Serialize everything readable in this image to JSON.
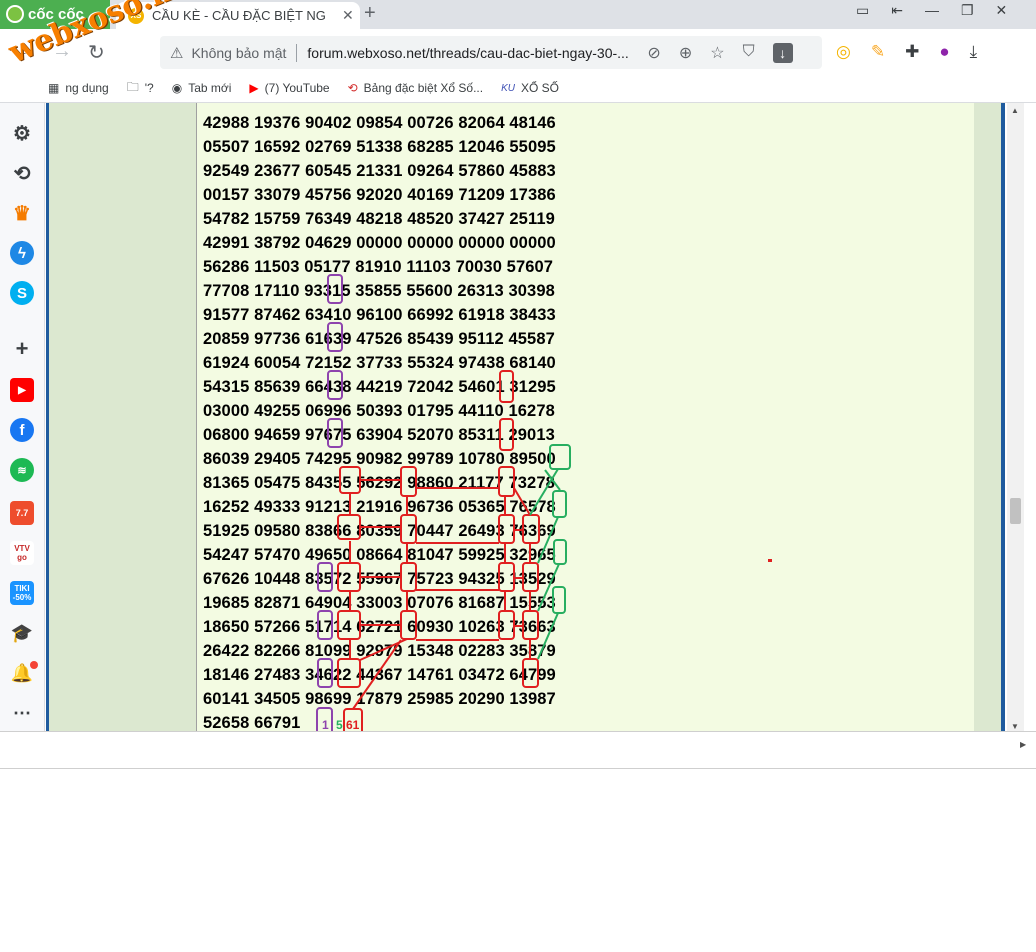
{
  "browser": {
    "brand": "cốc cốc",
    "tab_title": "CẦU KÈ - CẦU ĐẶC BIỆT NG",
    "tab_favicon": "XS",
    "tab_close": "✕",
    "new_tab": "+",
    "security_label": "Không bảo mật",
    "url": "forum.webxoso.net/threads/cau-dac-biet-ngay-30-..."
  },
  "bookmarks": [
    {
      "label": "ng dụng",
      "icon": "apps-icon"
    },
    {
      "label": "'?",
      "icon": "folder-icon"
    },
    {
      "label": "Tab mới",
      "icon": "globe-icon"
    },
    {
      "label": "(7) YouTube",
      "icon": "youtube-icon"
    },
    {
      "label": "Bảng đặc biệt Xổ Số...",
      "icon": "xs-icon"
    },
    {
      "label": "XỔ SỐ",
      "icon": "ku-icon"
    }
  ],
  "watermark": "webxoso.net",
  "sidebar": {
    "badges": {
      "shopee": "7.7",
      "vtv": "VTV go",
      "tiki": "TIKI -50%"
    }
  },
  "result_lines": [
    "42988 19376 90402 09854 00726 82064 48146",
    "05507 16592 02769 51338 68285 12046 55095",
    "92549 23677 60545 21331 09264 57860 45883",
    "00157 33079 45756 92020 40169 71209 17386",
    "54782 15759 76349 48218 48520 37427 25119",
    "42991 38792 04629 00000 00000 00000 00000",
    "56286 11503 05177 81910 11103 70030 57607",
    "77708 17110 93315 35855 55600 26313 30398",
    "91577 87462 63410 96100 66992 61918 38433",
    "20859 97736 61639 47526 85439 95112 45587",
    "61924 60054 72152 37733 55324 97438 68140",
    "54315 85639 66438 44219 72042 54601 31295",
    "03000 49255 06996 50393 01795 44110 16278",
    "06800 94659 97675 63904 52070 85311 29013",
    "86039 29405 74295 90982 99789 10780 89500",
    "81365 05475 84355 56292 98860 21177 73278",
    "16252 49333 91213 21916 96736 05365 76578",
    "51925 09580 83866 80359 70447 26493 76369",
    "54247 57470 49650 08664 81047 59925 32965",
    "67626 10448 83572 55967 75723 94325 13529",
    "19685 82871 64904 33003 07076 81687 15553",
    "18650 57266 51714 62721 60930 10263 73663",
    "26422 82266 81099 92979 15348 02283 35879",
    "18146 27483 34622 44367 14761 03472 64799",
    "60141 34505 98699 17879 25985 20290 13987",
    "52658 66791"
  ],
  "predictions": {
    "purple": "1",
    "green": "5",
    "red": "61"
  },
  "colors": {
    "red": "#e02020",
    "purple": "#8e44ad",
    "green": "#27ae60",
    "accent": "#1f5b9e"
  }
}
